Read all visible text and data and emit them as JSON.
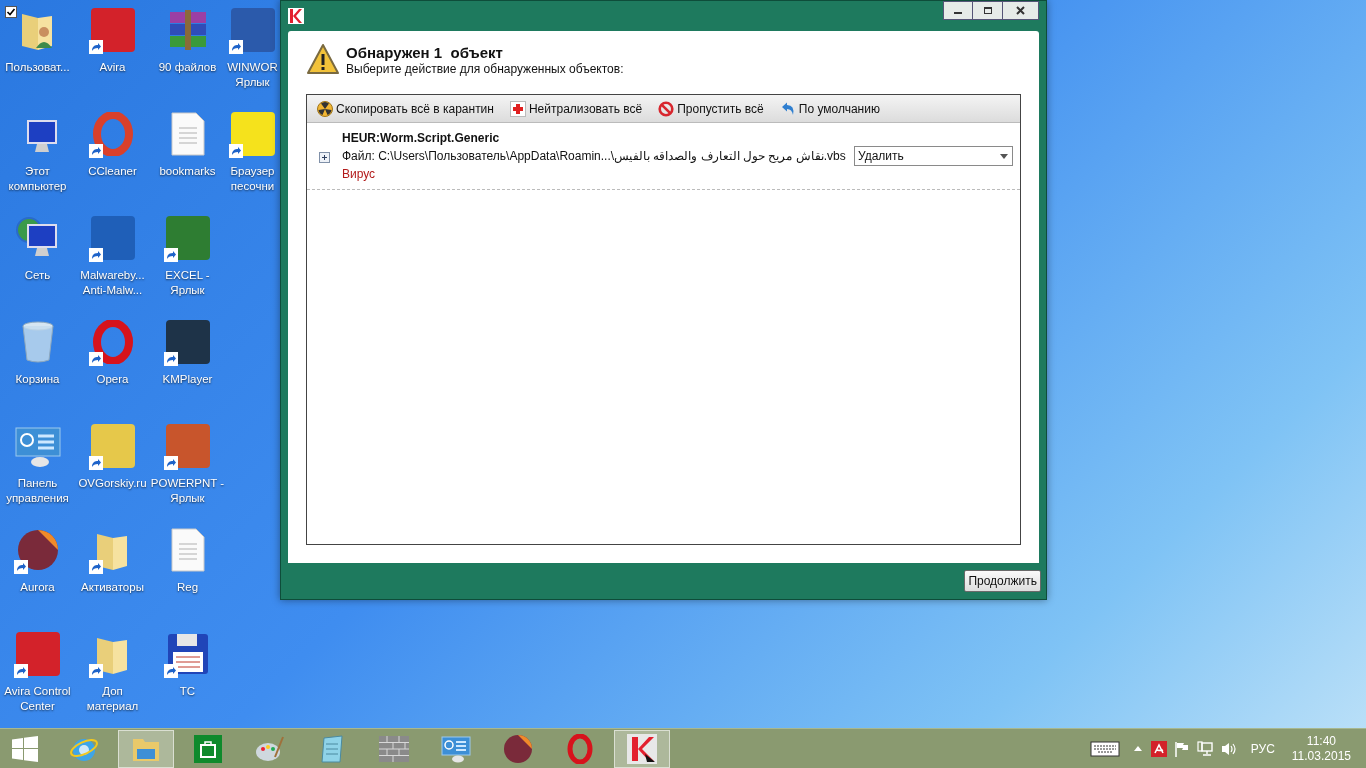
{
  "desktop": {
    "icons": [
      {
        "lines": [
          "Пользоват..."
        ],
        "kind": "user-folder",
        "shortcut": false,
        "selected": true
      },
      {
        "lines": [
          "Этот",
          "компьютер"
        ],
        "kind": "computer",
        "shortcut": false,
        "selected": false
      },
      {
        "lines": [
          "Сеть"
        ],
        "kind": "network",
        "shortcut": false,
        "selected": false
      },
      {
        "lines": [
          "Корзина"
        ],
        "kind": "trash",
        "shortcut": false,
        "selected": false
      },
      {
        "lines": [
          "Панель",
          "управления"
        ],
        "kind": "control-panel",
        "shortcut": false,
        "selected": false
      },
      {
        "lines": [
          "Aurora"
        ],
        "kind": "orb",
        "shortcut": true,
        "selected": false
      },
      {
        "lines": [
          "Avira Control",
          "Center"
        ],
        "kind": "tile",
        "color": "#d3222a",
        "shortcut": true,
        "selected": false
      },
      {
        "lines": [
          "Avira"
        ],
        "kind": "tile",
        "color": "#d3222a",
        "shortcut": true,
        "selected": false
      },
      {
        "lines": [
          "CCleaner"
        ],
        "kind": "ring",
        "color": "#d9402b",
        "shortcut": true,
        "selected": false
      },
      {
        "lines": [
          "Malwareby...",
          "Anti-Malw..."
        ],
        "kind": "tile",
        "color": "#1f5fb8",
        "shortcut": true,
        "selected": false
      },
      {
        "lines": [
          "Opera"
        ],
        "kind": "ring",
        "color": "#d7131c",
        "shortcut": true,
        "selected": false
      },
      {
        "lines": [
          "OVGorskiy.ru"
        ],
        "kind": "tile",
        "color": "#e6c84a",
        "shortcut": true,
        "selected": false
      },
      {
        "lines": [
          "Активаторы"
        ],
        "kind": "folder",
        "shortcut": true,
        "selected": false
      },
      {
        "lines": [
          "Доп",
          "материал"
        ],
        "kind": "folder",
        "shortcut": true,
        "selected": false
      },
      {
        "lines": [
          "90 файлов"
        ],
        "kind": "archive",
        "shortcut": false,
        "selected": false
      },
      {
        "lines": [
          "bookmarks"
        ],
        "kind": "document",
        "shortcut": false,
        "selected": false
      },
      {
        "lines": [
          "EXCEL -",
          "Ярлык"
        ],
        "kind": "tile",
        "color": "#2e7d32",
        "shortcut": true,
        "selected": false
      },
      {
        "lines": [
          "KMPlayer"
        ],
        "kind": "tile",
        "color": "#1e3348",
        "shortcut": true,
        "selected": false
      },
      {
        "lines": [
          "POWERPNT -",
          "Ярлык"
        ],
        "kind": "tile",
        "color": "#c8552c",
        "shortcut": true,
        "selected": false
      },
      {
        "lines": [
          "Reg"
        ],
        "kind": "document",
        "shortcut": false,
        "selected": false
      },
      {
        "lines": [
          "TC"
        ],
        "kind": "floppy",
        "shortcut": true,
        "selected": false
      },
      {
        "lines": [
          "WINWOR",
          "Ярлык"
        ],
        "kind": "tile",
        "color": "#2b5aab",
        "shortcut": true,
        "selected": false
      },
      {
        "lines": [
          "Браузер",
          "песочни"
        ],
        "kind": "tile",
        "color": "#f5e21c",
        "shortcut": true,
        "selected": false
      }
    ]
  },
  "window": {
    "heading": "Обнаружен 1  объект",
    "subheading": "Выберите действие для обнаруженных объектов:",
    "toolbar": [
      {
        "label": "Скопировать всё в карантин",
        "kind": "quarantine"
      },
      {
        "label": "Нейтрализовать всё",
        "kind": "disinfect"
      },
      {
        "label": "Пропустить всё",
        "kind": "skip"
      },
      {
        "label": "По умолчанию",
        "kind": "default"
      }
    ],
    "threats": [
      {
        "name": "HEUR:Worm.Script.Generic",
        "file": "Файл: C:\\Users\\Пользователь\\AppData\\Roamin...\\نقاش مريح حول التعارف والصداقه بالفيس.vbs",
        "action": "Удалить",
        "type": "Вирус",
        "expanded": false
      }
    ],
    "continue_button": "Продолжить"
  },
  "taskbar": {
    "apps": [
      {
        "kind": "ie",
        "active": false
      },
      {
        "kind": "explorer",
        "active": true
      },
      {
        "kind": "store",
        "active": false
      },
      {
        "kind": "paint",
        "active": false
      },
      {
        "kind": "notepad",
        "active": false
      },
      {
        "kind": "wall",
        "active": false
      },
      {
        "kind": "control",
        "active": false
      },
      {
        "kind": "orb",
        "active": false
      },
      {
        "kind": "opera",
        "active": false
      },
      {
        "kind": "kaspersky",
        "active": true
      }
    ],
    "language": "РУС",
    "time": "11:40",
    "date": "11.03.2015"
  }
}
